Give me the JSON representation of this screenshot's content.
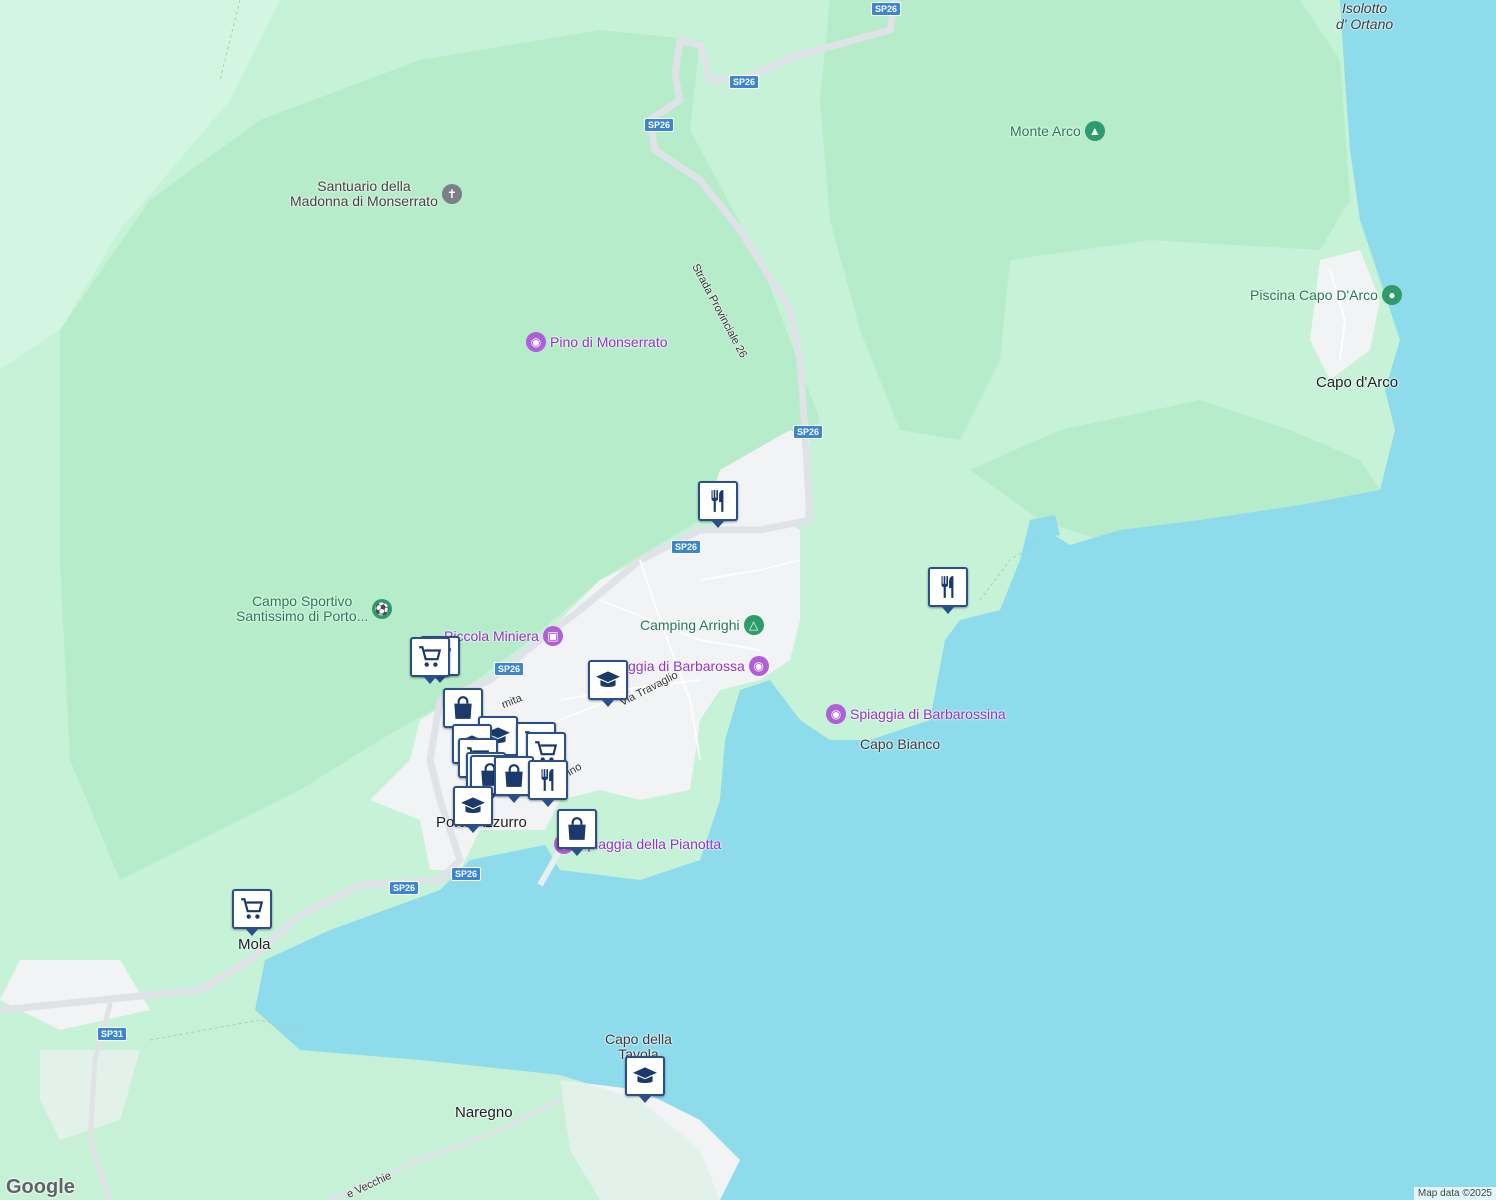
{
  "map": {
    "colors": {
      "water": "#8edbec",
      "land": "#c6f2d8",
      "forest": "#b6ebcc",
      "urban": "#f1f3f4",
      "road": "#dfe3e8",
      "shield": "#3b86cf"
    },
    "places": {
      "isolotto": "Isolotto\nd' Ortano",
      "monte_arco": "Monte Arco",
      "santuario": "Santuario della\nMadonna di Monserrato",
      "pino": "Pino di Monserrato",
      "piscina": "Piscina Capo D'Arco",
      "capo_darco": "Capo d'Arco",
      "campo_sportivo": "Campo Sportivo\nSantissimo di Porto...",
      "piccola_miniera": "Piccola Miniera",
      "camping": "Camping Arrighi",
      "barbarossa": "Spiaggia di Barbarossa",
      "barbarossina": "Spiaggia di Barbarossina",
      "capo_bianco": "Capo Bianco",
      "porto_azzurro": "Porto Azzurro",
      "pianotta": "Spiaggia della Pianotta",
      "mola": "Mola",
      "capo_tavola": "Capo della\nTavola",
      "naregno": "Naregno"
    },
    "streets": {
      "provinciale": "Strada Provinciale 26",
      "travaglio": "Via Travaglio",
      "vecchie": "e Vecchie",
      "amita": "mita",
      "rino": "rino"
    },
    "shields": {
      "sp26": "SP26",
      "sp31": "SP31"
    },
    "markers": [
      {
        "type": "restaurant",
        "icon": "fork-knife-icon"
      },
      {
        "type": "restaurant",
        "icon": "fork-knife-icon"
      },
      {
        "type": "supermarket",
        "icon": "shopping-cart-icon"
      },
      {
        "type": "shop",
        "icon": "shopping-bag-icon"
      },
      {
        "type": "school",
        "icon": "graduation-cap-icon"
      },
      {
        "type": "school",
        "icon": "graduation-cap-icon"
      },
      {
        "type": "shop",
        "icon": "shopping-bag-icon"
      },
      {
        "type": "restaurant",
        "icon": "fork-knife-icon"
      },
      {
        "type": "supermarket",
        "icon": "shopping-cart-icon"
      },
      {
        "type": "school",
        "icon": "graduation-cap-icon"
      }
    ],
    "attribution": {
      "logo": "Google",
      "credit": "Map data ©2025"
    }
  }
}
